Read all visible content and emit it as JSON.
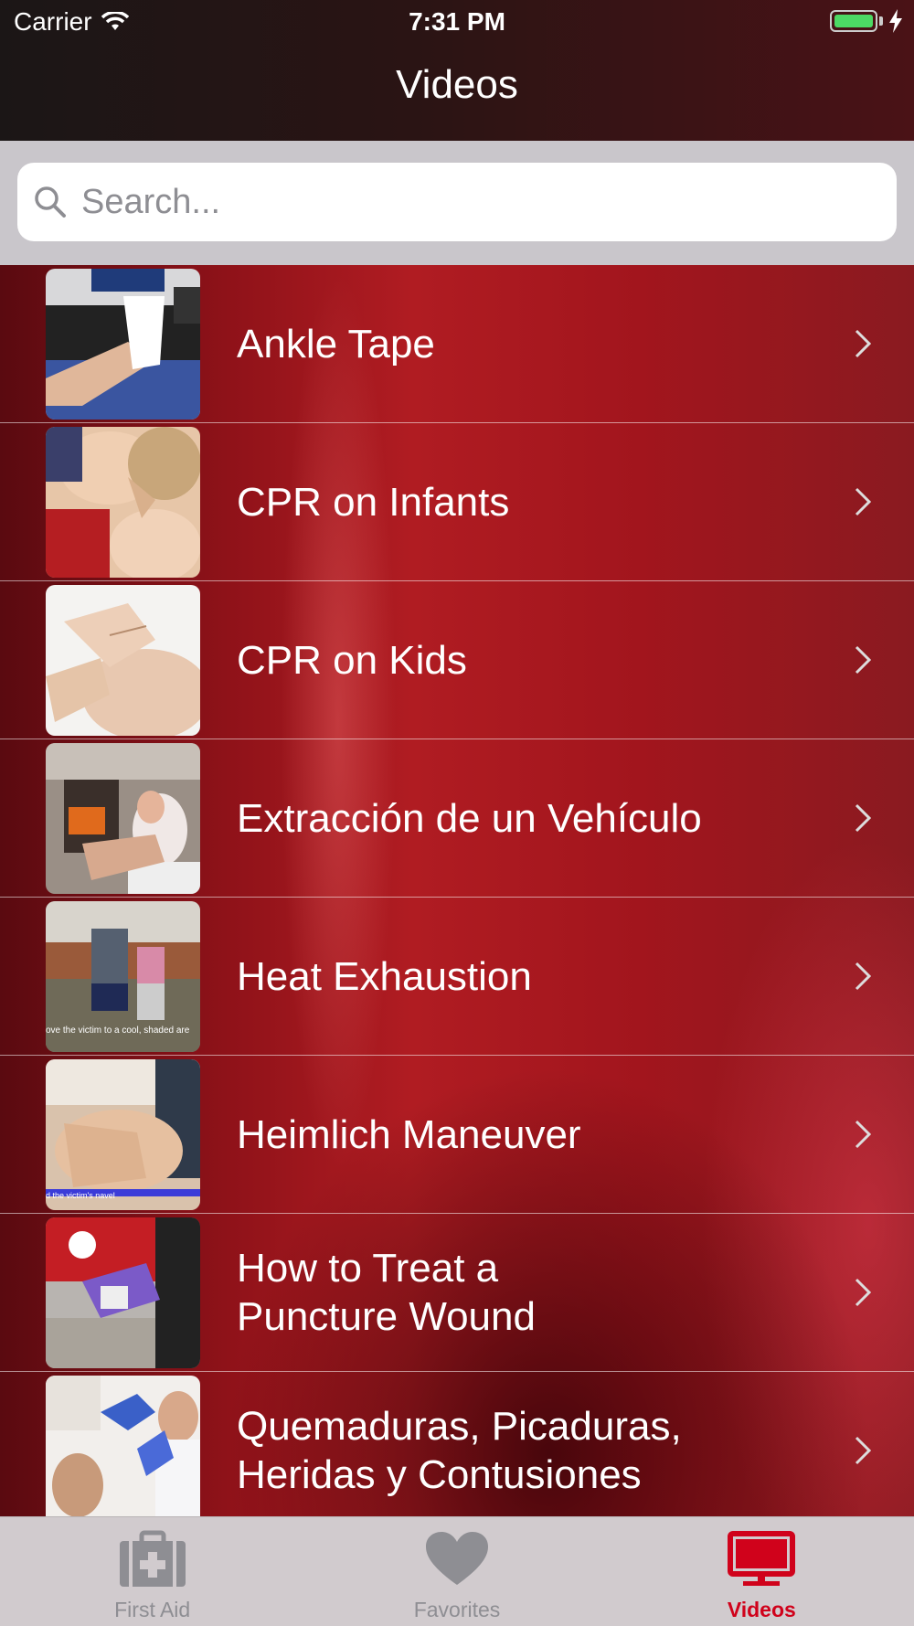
{
  "status_bar": {
    "carrier": "Carrier",
    "time": "7:31 PM"
  },
  "nav": {
    "title": "Videos"
  },
  "search": {
    "placeholder": "Search..."
  },
  "videos": [
    {
      "title": "Ankle Tape"
    },
    {
      "title": "CPR on Infants"
    },
    {
      "title": "CPR on Kids"
    },
    {
      "title": "Extracción de un Vehículo"
    },
    {
      "title": "Heat Exhaustion",
      "caption": "ove the victim to a cool, shaded are"
    },
    {
      "title": "Heimlich Maneuver",
      "caption": "d the victim's navel"
    },
    {
      "title": "How to Treat a\nPuncture Wound"
    },
    {
      "title": "Quemaduras, Picaduras,\nHeridas y Contusiones"
    }
  ],
  "tabs": [
    {
      "label": "First Aid",
      "icon": "first-aid-kit-icon",
      "active": false
    },
    {
      "label": "Favorites",
      "icon": "heart-icon",
      "active": false
    },
    {
      "label": "Videos",
      "icon": "tv-icon",
      "active": true
    }
  ],
  "colors": {
    "accent": "#d0021b",
    "tab_inactive": "#8e8e93",
    "battery": "#4cd964"
  }
}
